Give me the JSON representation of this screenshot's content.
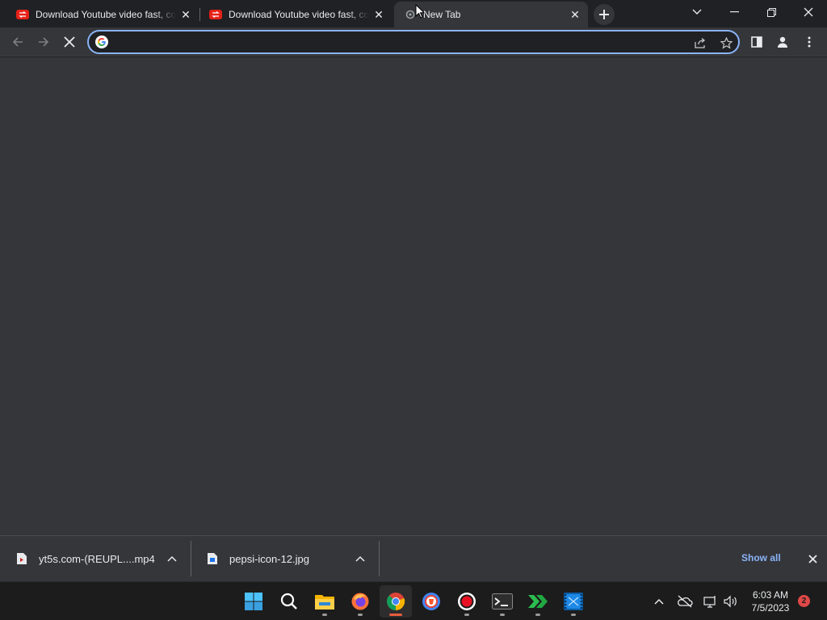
{
  "browser": {
    "tabs": [
      {
        "title": "Download Youtube video fast, co",
        "favicon": "yt5s-icon",
        "active": false
      },
      {
        "title": "Download Youtube video fast, co",
        "favicon": "yt5s-icon",
        "active": false
      },
      {
        "title": "New Tab",
        "favicon": "loading-icon",
        "active": true
      }
    ],
    "omnibox": {
      "value": "",
      "placeholder": ""
    },
    "colors": {
      "accent": "#8ab4f8",
      "tab_active": "#35363a",
      "frame": "#202124"
    }
  },
  "downloads": {
    "items": [
      {
        "name": "yt5s.com-(REUPL....mp4",
        "icon": "video-file-icon"
      },
      {
        "name": "pepsi-icon-12.jpg",
        "icon": "image-file-icon"
      }
    ],
    "show_all": "Show all"
  },
  "taskbar": {
    "apps": [
      "windows-start",
      "search",
      "file-explorer",
      "firefox",
      "chrome",
      "brave",
      "screen-recorder",
      "terminal",
      "green-arrows-app",
      "video-editor"
    ],
    "clock": {
      "time": "6:03 AM",
      "date": "7/5/2023"
    },
    "notifications": "2"
  }
}
